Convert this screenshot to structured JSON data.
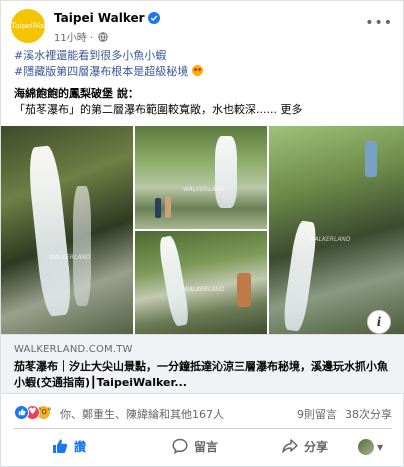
{
  "post": {
    "avatar_text": "TaipeiWalker",
    "page_name": "Taipei Walker",
    "time": "11小時",
    "dot": "·",
    "line1_hash": "#溪水裡還能看到很多小魚小蝦",
    "line2_hash": "#隱藏版第四層瀑布根本是超級秘境",
    "line3": "海綿飽飽的鳳梨破堡 說：",
    "line4": "「茄苳瀑布」的第二層瀑布範圍較寬敞，水也較深...... 更多"
  },
  "photos": {
    "watermark": "WALKERLAND"
  },
  "link": {
    "domain": "WALKERLAND.COM.TW",
    "title": "茄苳瀑布｜汐止大尖山景點，一分鐘抵達沁涼三層瀑布秘境，溪邊玩水抓小魚小蝦(交通指南)┃TaipeiWalker..."
  },
  "reactions": {
    "names": "你、鄭重生、陳緯綸和其他167人",
    "comments": "9則留言",
    "shares": "38次分享"
  },
  "actions": {
    "like": "讚",
    "comment": "留言",
    "share": "分享"
  },
  "colors": {
    "accent": "#1877f2",
    "love": "#f33e58",
    "wow": "#f7b125"
  },
  "icons": [
    "verified-icon",
    "globe-icon",
    "more-icon",
    "info-icon",
    "like-icon",
    "comment-icon",
    "share-icon",
    "avatar-icon"
  ]
}
